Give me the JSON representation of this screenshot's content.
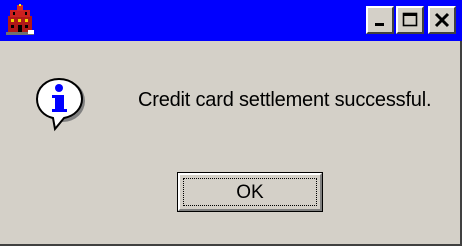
{
  "window": {
    "title_icon": "red-building-icon",
    "title_bar_color": "#0000ff",
    "controls": {
      "minimize": "minimize-icon",
      "maximize": "maximize-icon",
      "close": "close-icon"
    }
  },
  "dialog": {
    "icon": "information-speech-bubble-icon",
    "message": "Credit card settlement successful.",
    "ok_label": "OK"
  }
}
